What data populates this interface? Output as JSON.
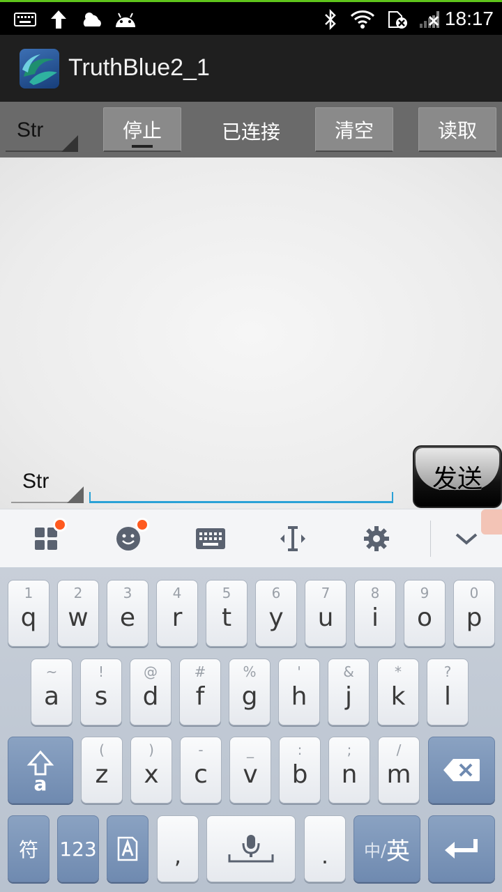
{
  "status_bar": {
    "time": "18:17",
    "left_icons": [
      "keyboard-icon",
      "upload-arrow-icon",
      "weather-icon",
      "android-icon"
    ],
    "right_icons": [
      "bluetooth-icon",
      "wifi-icon",
      "sim-error-icon",
      "signal-icon"
    ]
  },
  "app": {
    "title": "TruthBlue2_1",
    "accent": "#2aa1d6"
  },
  "toolbar": {
    "format_spinner": "Str",
    "stop_label": "停止",
    "status_label": "已连接",
    "clear_label": "清空",
    "read_label": "读取"
  },
  "send_area": {
    "format_spinner": "Str",
    "input_value": "",
    "send_label": "发送"
  },
  "keyboard": {
    "toolbar_icons": [
      "apps-icon",
      "emoji-icon",
      "keyboard-icon",
      "cursor-icon",
      "settings-icon",
      "collapse-chevron-icon"
    ],
    "row1": [
      {
        "hint": "1",
        "key": "q"
      },
      {
        "hint": "2",
        "key": "w"
      },
      {
        "hint": "3",
        "key": "e"
      },
      {
        "hint": "4",
        "key": "r"
      },
      {
        "hint": "5",
        "key": "t"
      },
      {
        "hint": "6",
        "key": "y"
      },
      {
        "hint": "7",
        "key": "u"
      },
      {
        "hint": "8",
        "key": "i"
      },
      {
        "hint": "9",
        "key": "o"
      },
      {
        "hint": "0",
        "key": "p"
      }
    ],
    "row2": [
      {
        "hint": "~",
        "key": "a"
      },
      {
        "hint": "!",
        "key": "s"
      },
      {
        "hint": "@",
        "key": "d"
      },
      {
        "hint": "#",
        "key": "f"
      },
      {
        "hint": "%",
        "key": "g"
      },
      {
        "hint": "'",
        "key": "h"
      },
      {
        "hint": "&",
        "key": "j"
      },
      {
        "hint": "*",
        "key": "k"
      },
      {
        "hint": "?",
        "key": "l"
      }
    ],
    "row3": [
      {
        "hint": "(",
        "key": "z"
      },
      {
        "hint": ")",
        "key": "x"
      },
      {
        "hint": "-",
        "key": "c"
      },
      {
        "hint": "_",
        "key": "v"
      },
      {
        "hint": ":",
        "key": "b"
      },
      {
        "hint": ";",
        "key": "n"
      },
      {
        "hint": "/",
        "key": "m"
      }
    ],
    "shift_label": "a",
    "symbols_label": "符",
    "numbers_label": "123",
    "comma_label": ",",
    "period_label": ".",
    "lang_small": "中/",
    "lang_big": "英"
  }
}
